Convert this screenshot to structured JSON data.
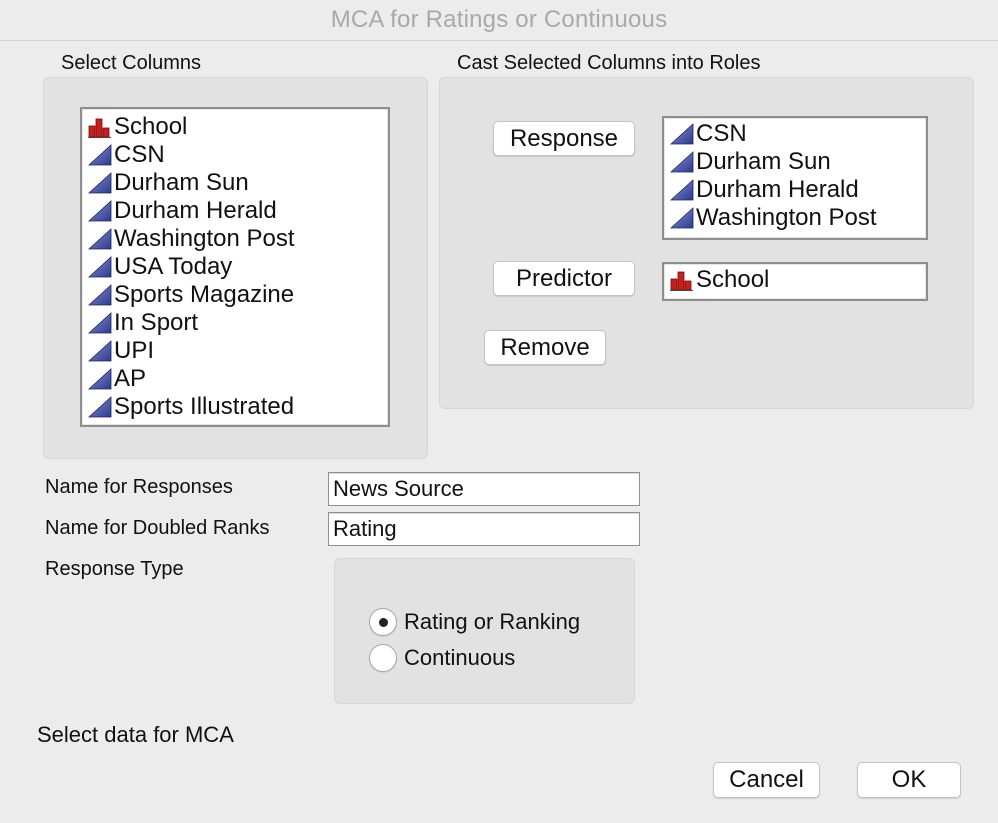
{
  "window": {
    "title": "MCA for Ratings or Continuous"
  },
  "select_columns": {
    "label": "Select Columns",
    "items": [
      {
        "label": "School",
        "icon": "nominal-bar-icon"
      },
      {
        "label": "CSN",
        "icon": "continuous-triangle-icon"
      },
      {
        "label": "Durham Sun",
        "icon": "continuous-triangle-icon"
      },
      {
        "label": "Durham Herald",
        "icon": "continuous-triangle-icon"
      },
      {
        "label": "Washington Post",
        "icon": "continuous-triangle-icon"
      },
      {
        "label": "USA Today",
        "icon": "continuous-triangle-icon"
      },
      {
        "label": "Sports Magazine",
        "icon": "continuous-triangle-icon"
      },
      {
        "label": "In Sport",
        "icon": "continuous-triangle-icon"
      },
      {
        "label": "UPI",
        "icon": "continuous-triangle-icon"
      },
      {
        "label": "AP",
        "icon": "continuous-triangle-icon"
      },
      {
        "label": "Sports Illustrated",
        "icon": "continuous-triangle-icon"
      }
    ]
  },
  "cast_roles": {
    "label": "Cast Selected Columns into Roles",
    "response_button": "Response",
    "response_items": [
      {
        "label": "CSN",
        "icon": "continuous-triangle-icon"
      },
      {
        "label": "Durham Sun",
        "icon": "continuous-triangle-icon"
      },
      {
        "label": "Durham Herald",
        "icon": "continuous-triangle-icon"
      },
      {
        "label": "Washington Post",
        "icon": "continuous-triangle-icon"
      }
    ],
    "predictor_button": "Predictor",
    "predictor_items": [
      {
        "label": "School",
        "icon": "nominal-bar-icon"
      }
    ],
    "remove_button": "Remove"
  },
  "fields": {
    "responses_label": "Name for Responses",
    "responses_value": "News Source",
    "doubled_ranks_label": "Name for Doubled Ranks",
    "doubled_ranks_value": "Rating"
  },
  "response_type": {
    "label": "Response Type",
    "options": [
      {
        "label": "Rating or Ranking",
        "selected": true
      },
      {
        "label": "Continuous",
        "selected": false
      }
    ]
  },
  "status": "Select data for MCA",
  "buttons": {
    "cancel": "Cancel",
    "ok": "OK"
  },
  "colors": {
    "continuous_icon": "#2b3a8c",
    "nominal_icon": "#c81e1e"
  }
}
